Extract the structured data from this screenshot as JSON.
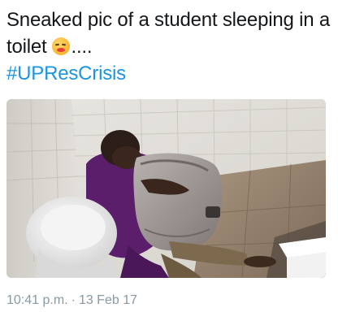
{
  "tweet": {
    "text_line1": "Sneaked pic of a student sleeping in a",
    "text_line2_prefix": "toilet",
    "emoji": "tired-face-emoji",
    "text_line2_suffix": "....",
    "hashtag": "#UPResCrisis",
    "photo_icon": "bathroom-photo",
    "time": "10:41 p.m.",
    "separator": "·",
    "date": "13 Feb 17"
  },
  "colors": {
    "text": "#14171a",
    "hashtag": "#1b95e0",
    "meta": "#8899a6"
  }
}
